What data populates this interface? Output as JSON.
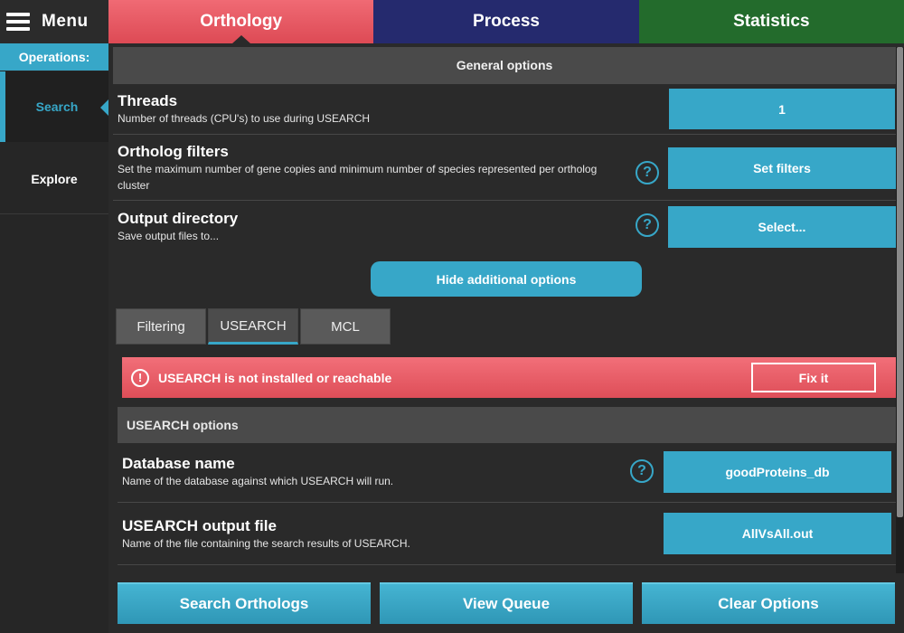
{
  "menu": {
    "label": "Menu"
  },
  "sidebar": {
    "operations_label": "Operations:",
    "items": [
      {
        "label": "Search"
      },
      {
        "label": "Explore"
      }
    ]
  },
  "tabs": [
    {
      "label": "Orthology",
      "color": "#e85a64"
    },
    {
      "label": "Process",
      "color": "#252a6e"
    },
    {
      "label": "Statistics",
      "color": "#236b2c"
    }
  ],
  "general": {
    "header": "General options",
    "threads": {
      "title": "Threads",
      "desc": "Number of threads (CPU's) to use during USEARCH",
      "value": "1"
    },
    "ortholog_filters": {
      "title": "Ortholog filters",
      "desc": "Set the maximum number of gene copies and minimum number of species represented per ortholog cluster",
      "button": "Set filters"
    },
    "output_dir": {
      "title": "Output directory",
      "desc": "Save output files to...",
      "button": "Select..."
    }
  },
  "additional": {
    "hide_button": "Hide additional options",
    "subtabs": [
      "Filtering",
      "USEARCH",
      "MCL"
    ]
  },
  "error": {
    "icon": "!",
    "message": "USEARCH is not installed or reachable",
    "fix_button": "Fix it"
  },
  "usearch": {
    "header": "USEARCH options",
    "database": {
      "title": "Database name",
      "desc": "Name of the database against which USEARCH will run.",
      "value": "goodProteins_db"
    },
    "output_file": {
      "title": "USEARCH output file",
      "desc": "Name of the file containing the search results of USEARCH.",
      "value": "AllVsAll.out"
    }
  },
  "help_glyph": "?",
  "bottom": {
    "search_orthologs": "Search Orthologs",
    "view_queue": "View Queue",
    "clear_options": "Clear Options"
  },
  "colors": {
    "accent": "#37a7c8",
    "error": "#e85a64"
  }
}
